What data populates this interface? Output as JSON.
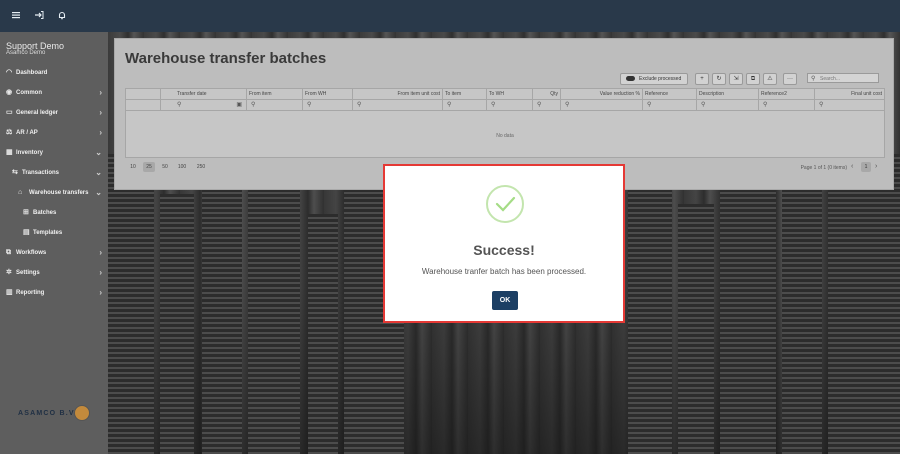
{
  "topbar": {
    "icons": [
      "menu-icon",
      "logout-icon",
      "bell-icon"
    ]
  },
  "sidebar": {
    "brand_name": "Support Demo",
    "brand_sub": "Asamco Demo",
    "items": [
      {
        "label": "Dashboard",
        "icon": "dashboard-icon"
      },
      {
        "label": "Common",
        "icon": "common-icon"
      },
      {
        "label": "General ledger",
        "icon": "ledger-icon"
      },
      {
        "label": "AR / AP",
        "icon": "arap-icon"
      },
      {
        "label": "Inventory",
        "icon": "inventory-icon"
      },
      {
        "label": "Transactions",
        "icon": "transactions-icon"
      },
      {
        "label": "Warehouse transfers",
        "icon": "warehouse-icon"
      },
      {
        "label": "Batches",
        "icon": "batches-icon"
      },
      {
        "label": "Templates",
        "icon": "templates-icon"
      },
      {
        "label": "Workflows",
        "icon": "workflows-icon"
      },
      {
        "label": "Settings",
        "icon": "settings-icon"
      },
      {
        "label": "Reporting",
        "icon": "reporting-icon"
      }
    ],
    "logo_text": "ASAMCO B.V."
  },
  "page": {
    "title": "Warehouse transfer batches",
    "exclude_processed": "Exclude processed",
    "search_placeholder": "Search...",
    "columns": [
      "Transfer date",
      "From item",
      "From WH",
      "From item unit cost",
      "To item",
      "To WH",
      "Qty",
      "Value reduction %",
      "Reference",
      "Description",
      "Reference2",
      "Final unit cost"
    ],
    "no_data": "No data",
    "page_sizes": [
      "10",
      "25",
      "50",
      "100",
      "250"
    ],
    "page_info": "Page 1 of 1 (0 items)",
    "current_page": "1"
  },
  "dialog": {
    "title": "Success!",
    "message": "Warehouse tranfer batch has been processed.",
    "ok_label": "OK"
  }
}
